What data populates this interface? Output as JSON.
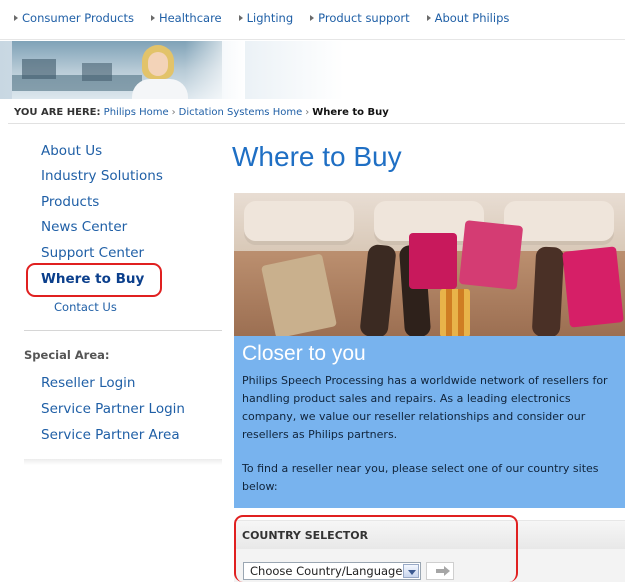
{
  "top_nav": {
    "items": [
      "Consumer Products",
      "Healthcare",
      "Lighting",
      "Product support",
      "About Philips"
    ]
  },
  "breadcrumb": {
    "label": "YOU ARE HERE:",
    "items": [
      "Philips Home",
      "Dictation Systems Home",
      "Where to Buy"
    ]
  },
  "sidebar": {
    "items": [
      "About Us",
      "Industry Solutions",
      "Products",
      "News Center",
      "Support Center",
      "Where to Buy"
    ],
    "sub_items": [
      "Contact Us"
    ],
    "special_label": "Special Area:",
    "special_items": [
      "Reseller Login",
      "Service Partner Login",
      "Service Partner Area"
    ]
  },
  "main": {
    "title": "Where to Buy",
    "promo": {
      "heading": "Closer to you",
      "paragraph1": "Philips Speech Processing has a worldwide network of resellers for handling product sales and repairs. As a leading electronics company, we value our reseller relationships and consider our resellers as Philips partners.",
      "paragraph2": "To find a reseller near you, please select one of our country sites below:"
    },
    "country_selector": {
      "heading": "COUNTRY SELECTOR",
      "selected": "Choose Country/Language"
    }
  },
  "colors": {
    "link": "#1f5fa6",
    "title_blue": "#1f6fc4",
    "panel_blue": "#78b3ee",
    "highlight_red": "#e02020"
  }
}
